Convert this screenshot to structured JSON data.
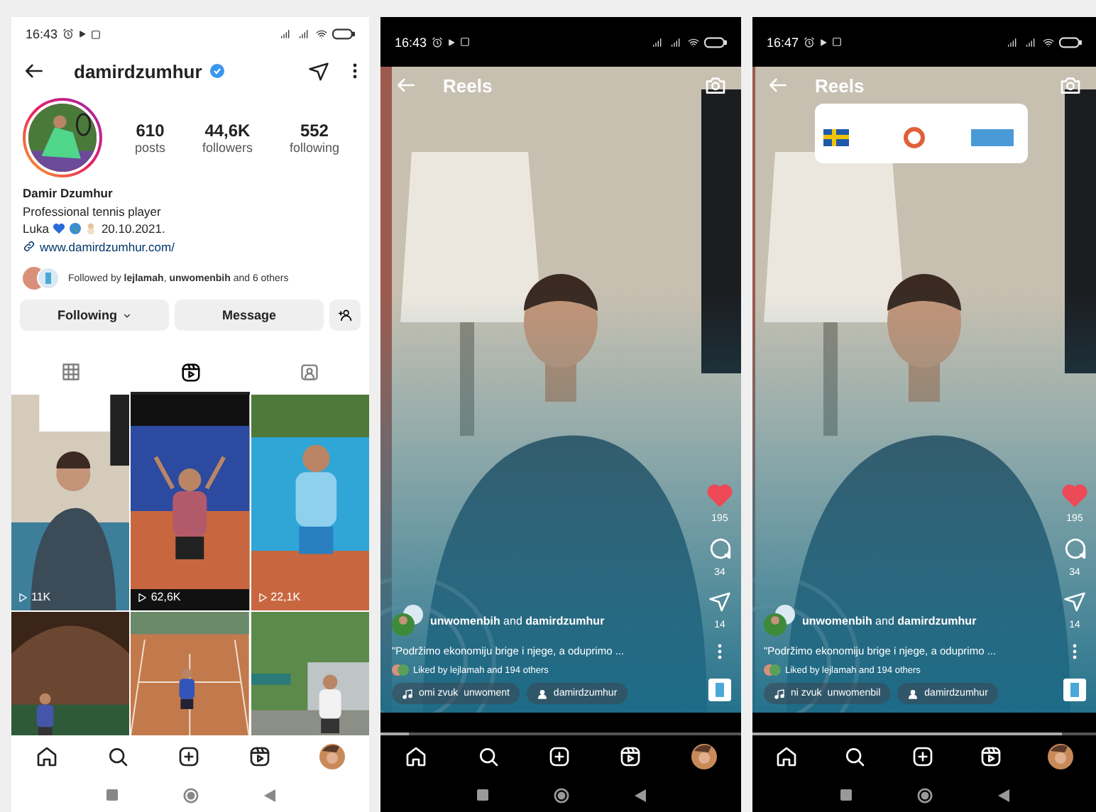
{
  "phones": [
    {
      "kind": "profile",
      "status_bar": {
        "time": "16:43"
      },
      "username": "damirdzumhur",
      "verified": true,
      "stats": [
        {
          "value": "610",
          "label": "posts"
        },
        {
          "value": "44,6K",
          "label": "followers"
        },
        {
          "value": "552",
          "label": "following"
        }
      ],
      "name": "Damir Dzumhur",
      "bio": "Professional tennis player",
      "dedication": {
        "name": "Luka",
        "date": "20.10.2021."
      },
      "link": "www.damirdzumhur.com/",
      "followed_by": "Followed by **lejlamah**, **unwomenbih** and 6 others",
      "actions": [
        {
          "label": "Following",
          "kind": "dropdown"
        },
        {
          "label": "Message",
          "kind": "plain"
        }
      ],
      "tabs": [
        {
          "selected": false
        },
        {
          "selected": true
        },
        {
          "selected": false
        }
      ],
      "thumbnails": [
        {
          "kind": "picture",
          "views": "11K"
        },
        {
          "kind": "picture",
          "views": "62,6K"
        },
        {
          "kind": "picture",
          "views": "22,1K"
        },
        {
          "kind": "picture"
        },
        {
          "kind": "picture"
        },
        {
          "kind": "picture"
        }
      ]
    },
    {
      "kind": "reels",
      "status_bar": {
        "time": "16:43"
      },
      "title": "Reels",
      "liked": true,
      "likes": "195",
      "comments": "34",
      "shares": "14",
      "authors": "**unwomenbih** and **damirdzumhur**",
      "caption": "\"Podržimo ekonomiju brige i njege, a oduprimo ...",
      "liked_by": "Liked by lejlamah and 194 others",
      "audio": [
        "omi zvuk",
        "unwoment"
      ],
      "tagged": "damirdzumhur",
      "progress": {
        "level": 0.08
      }
    },
    {
      "kind": "reels",
      "status_bar": {
        "time": "16:47"
      },
      "title": "Reels",
      "liked": true,
      "likes": "195",
      "comments": "34",
      "shares": "14",
      "authors": "**unwomenbih** and **damirdzumhur**",
      "caption": "\"Podržimo ekonomiju brige i njege, a oduprimo ...",
      "liked_by": "Liked by lejlamah and 194 others",
      "audio": [
        "ni zvuk",
        "unwomenbil"
      ],
      "tagged": "damirdzumhur",
      "progress": {
        "level": 0.9
      }
    }
  ]
}
